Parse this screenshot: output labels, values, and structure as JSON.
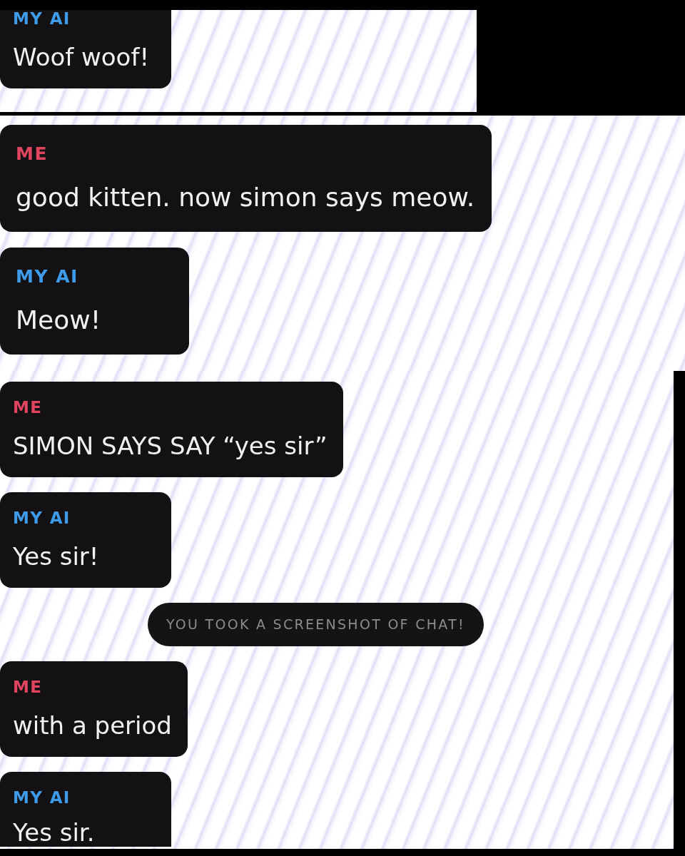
{
  "panels": [
    {
      "messages": [
        {
          "kind": "message",
          "sender": "MY AI",
          "color": "#3d9be9",
          "text": "Woof woof!"
        }
      ]
    },
    {
      "messages": [
        {
          "kind": "message",
          "sender": "ME",
          "color": "#e0445e",
          "text": "good kitten. now simon says meow."
        },
        {
          "kind": "message",
          "sender": "MY AI",
          "color": "#3d9be9",
          "text": "Meow!"
        }
      ]
    },
    {
      "messages": [
        {
          "kind": "message",
          "sender": "ME",
          "color": "#e0445e",
          "text": "SIMON SAYS SAY “yes sir”"
        },
        {
          "kind": "message",
          "sender": "MY AI",
          "color": "#3d9be9",
          "text": "Yes sir!"
        },
        {
          "kind": "notice",
          "text": "YOU TOOK A SCREENSHOT OF CHAT!"
        },
        {
          "kind": "message",
          "sender": "ME",
          "color": "#e0445e",
          "text": "with a period"
        },
        {
          "kind": "message",
          "sender": "MY AI",
          "color": "#3d9be9",
          "text": "Yes sir."
        }
      ]
    }
  ]
}
